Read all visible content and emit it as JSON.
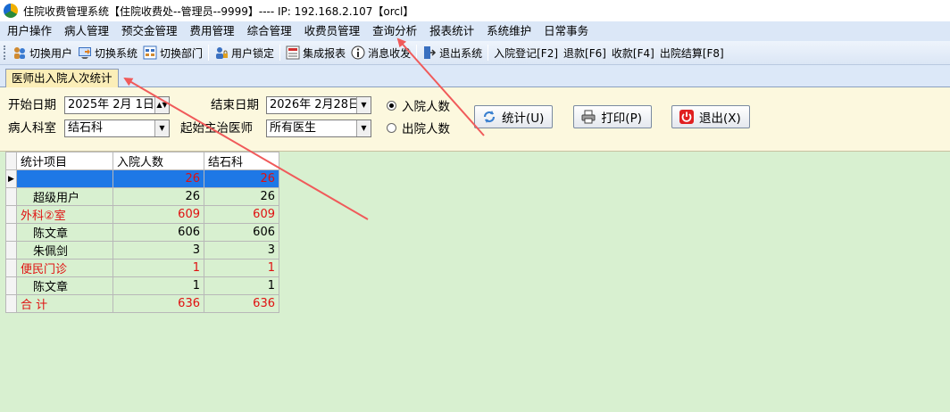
{
  "window": {
    "title": "住院收费管理系统【住院收费处--管理员--9999】---- IP:  192.168.2.107【orcl】"
  },
  "menu": [
    {
      "label": "用户操作"
    },
    {
      "label": "病人管理"
    },
    {
      "label": "预交金管理"
    },
    {
      "label": "费用管理"
    },
    {
      "label": "综合管理"
    },
    {
      "label": "收费员管理"
    },
    {
      "label": "查询分析"
    },
    {
      "label": "报表统计"
    },
    {
      "label": "系统维护"
    },
    {
      "label": "日常事务"
    }
  ],
  "toolbar": {
    "switch_user": "切换用户",
    "switch_system": "切换系统",
    "switch_dept": "切换部门",
    "lock_user": "用户锁定",
    "integrated_report": "集成报表",
    "message": "消息收发",
    "exit_system": "退出系统",
    "admission": "入院登记[F2]",
    "refund": "退款[F6]",
    "charge": "收款[F4]",
    "discharge": "出院结算[F8]"
  },
  "tab": {
    "active_label": "医师出入院人次统计"
  },
  "filters": {
    "start_date_label": "开始日期",
    "start_date_value": "2025年  2月  1日",
    "end_date_label": "结束日期",
    "end_date_value": "2026年  2月28日",
    "dept_label": "病人科室",
    "dept_value": "结石科",
    "doctor_label": "起始主治医师",
    "doctor_value": "所有医生",
    "radio_admission": "入院人数",
    "radio_discharge": "出院人数",
    "radio_selected": "入院人数"
  },
  "buttons": {
    "stats": "统计(U)",
    "print": "打印(P)",
    "exit": "退出(X)"
  },
  "grid": {
    "headers": [
      "统计项目",
      "入院人数",
      "结石科"
    ],
    "rows": [
      {
        "item": "",
        "admissions": "26",
        "dept": "26",
        "red": true,
        "selected": true,
        "indent": false
      },
      {
        "item": "超级用户",
        "admissions": "26",
        "dept": "26",
        "red": false,
        "selected": false,
        "indent": true
      },
      {
        "item": "外科②室",
        "admissions": "609",
        "dept": "609",
        "red": true,
        "selected": false,
        "indent": false
      },
      {
        "item": "陈文章",
        "admissions": "606",
        "dept": "606",
        "red": false,
        "selected": false,
        "indent": true
      },
      {
        "item": "朱佩剑",
        "admissions": "3",
        "dept": "3",
        "red": false,
        "selected": false,
        "indent": true
      },
      {
        "item": "便民门诊",
        "admissions": "1",
        "dept": "1",
        "red": true,
        "selected": false,
        "indent": false
      },
      {
        "item": "陈文章",
        "admissions": "1",
        "dept": "1",
        "red": false,
        "selected": false,
        "indent": true
      },
      {
        "item": "合  计",
        "admissions": "636",
        "dept": "636",
        "red": true,
        "selected": false,
        "indent": false
      }
    ]
  },
  "colors": {
    "accent_red": "#e01010",
    "selected_row": "#1e78e6",
    "grid_bg": "#d8f0d0",
    "filter_bg": "#fcf8de",
    "tab_active": "#fbeeb8",
    "annotation_arrow": "#f05a5a"
  }
}
